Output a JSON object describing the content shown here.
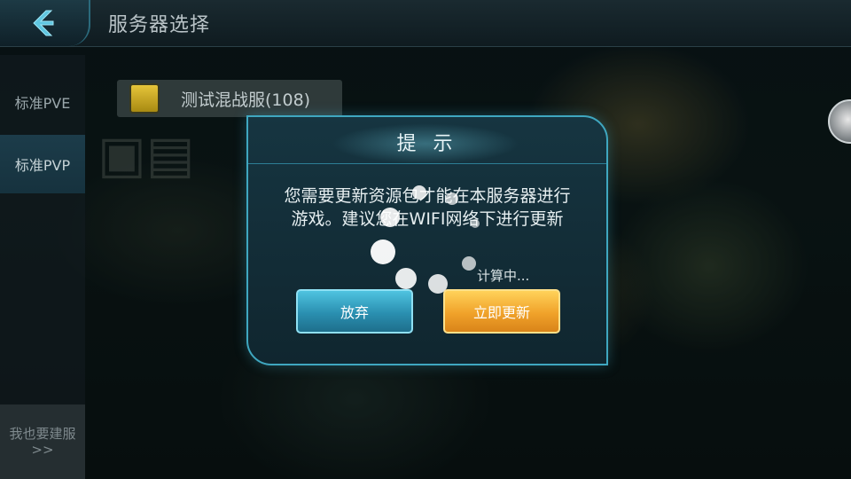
{
  "header": {
    "title": "服务器选择",
    "back_icon": "back-arrow-icon"
  },
  "sidebar": {
    "items": [
      {
        "label": "标准PVE",
        "active": false
      },
      {
        "label": "标准PVP",
        "active": true
      }
    ],
    "build_label": "我也要建服>>"
  },
  "server_list": [
    {
      "name": "测试混战服(108)",
      "status_color": "#d8b52a"
    }
  ],
  "dialog": {
    "title": "提 示",
    "message_line1": "您需要更新资源包才能在本服务器进行",
    "message_line2": "游戏。建议您在WIFI网络下进行更新",
    "calc_text": "计算中...",
    "cancel_label": "放弃",
    "update_label": "立即更新"
  },
  "colors": {
    "accent": "#3fa7c0",
    "cancel_button": "#2a8fb0",
    "update_button": "#f0a22a"
  }
}
